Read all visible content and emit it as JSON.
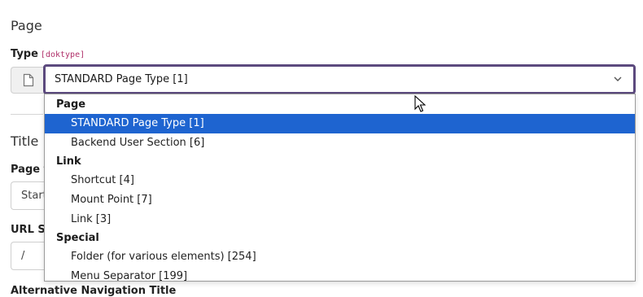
{
  "page_section": {
    "title": "Page"
  },
  "type_field": {
    "label": "Type",
    "code": "[doktype]",
    "selected_value": "STANDARD Page Type [1]",
    "addon_icon": "page-icon",
    "chevron_icon": "chevron-down-icon"
  },
  "dropdown": {
    "groups": [
      {
        "label": "Page",
        "options": [
          {
            "label": "STANDARD Page Type [1]",
            "selected": true
          },
          {
            "label": "Backend User Section [6]",
            "selected": false
          }
        ]
      },
      {
        "label": "Link",
        "options": [
          {
            "label": "Shortcut [4]",
            "selected": false
          },
          {
            "label": "Mount Point [7]",
            "selected": false
          },
          {
            "label": "Link [3]",
            "selected": false
          }
        ]
      },
      {
        "label": "Special",
        "options": [
          {
            "label": "Folder (for various elements) [254]",
            "selected": false
          },
          {
            "label": "Menu Separator [199]",
            "selected": false
          }
        ]
      }
    ]
  },
  "title_section": {
    "title": "Title"
  },
  "background_fields": {
    "page_title_label": "Page t",
    "page_title_value": "Start",
    "url_label": "URL Se",
    "url_value": "/",
    "alt_nav_label": "Alternative Navigation Title"
  },
  "colors": {
    "selected_bg": "#1e64d0",
    "focus_border": "#5c4a7e",
    "code": "#b0306a"
  }
}
